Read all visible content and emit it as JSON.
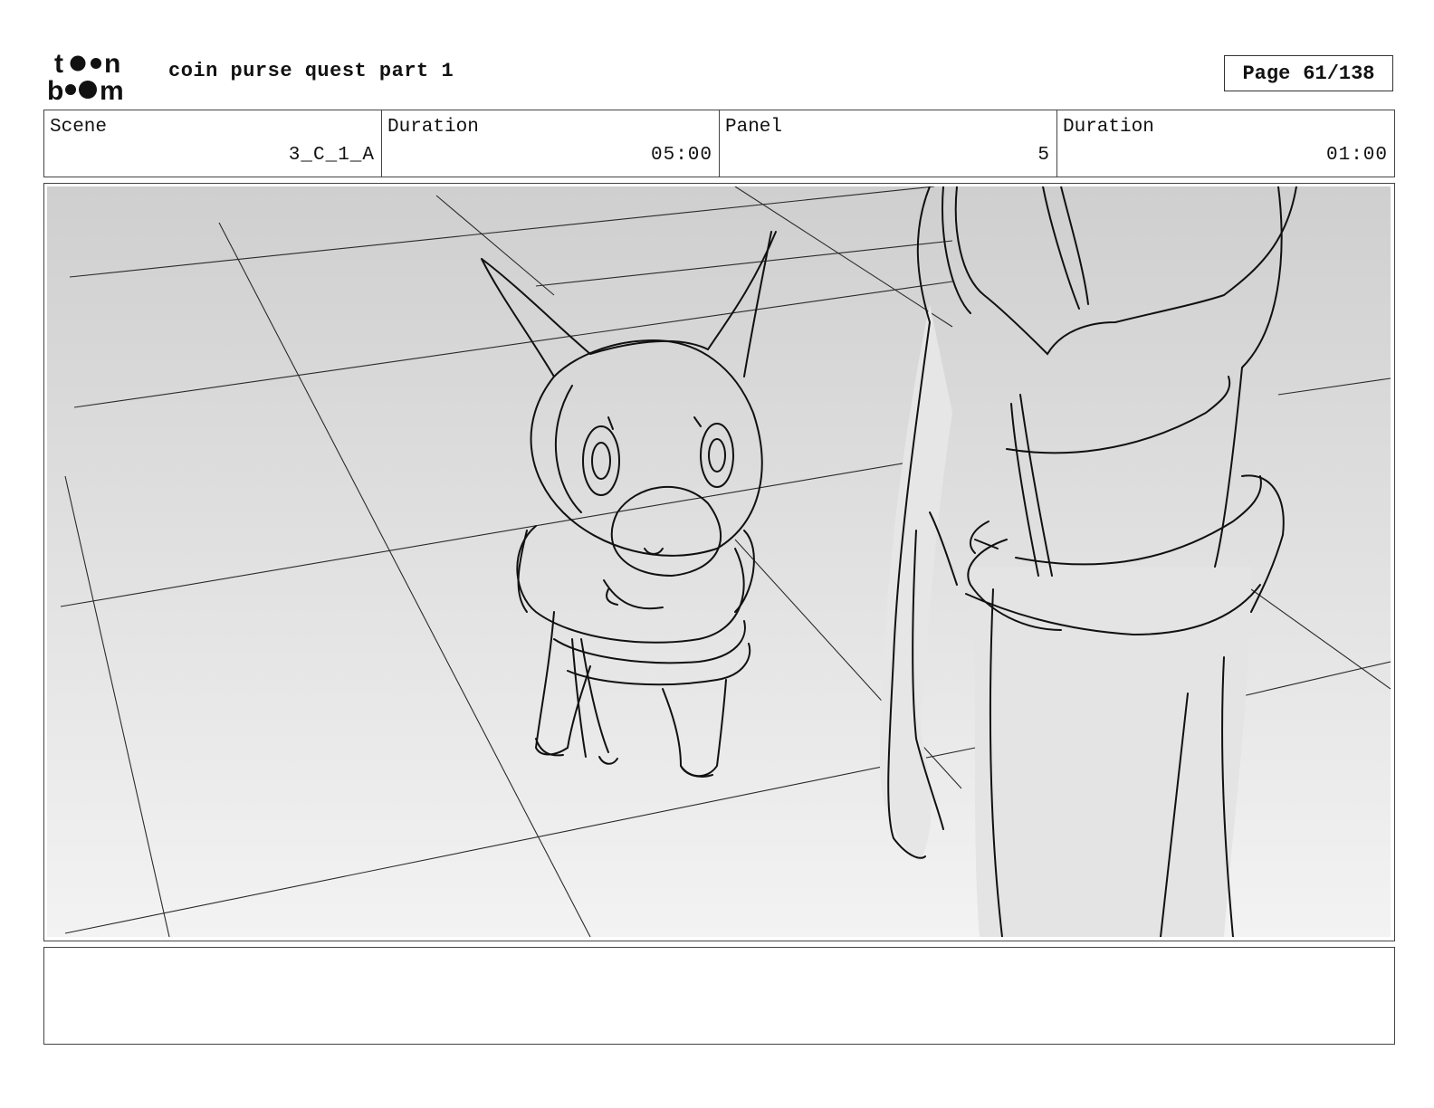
{
  "header": {
    "project_title": "coin purse quest part 1",
    "page_label": "Page",
    "page_number": "61/138"
  },
  "info": {
    "scene_label": "Scene",
    "scene_value": "3_C_1_A",
    "scene_duration_label": "Duration",
    "scene_duration_value": "05:00",
    "panel_label": "Panel",
    "panel_value": "5",
    "panel_duration_label": "Duration",
    "panel_duration_value": "01:00"
  },
  "notes": {
    "text": ""
  }
}
